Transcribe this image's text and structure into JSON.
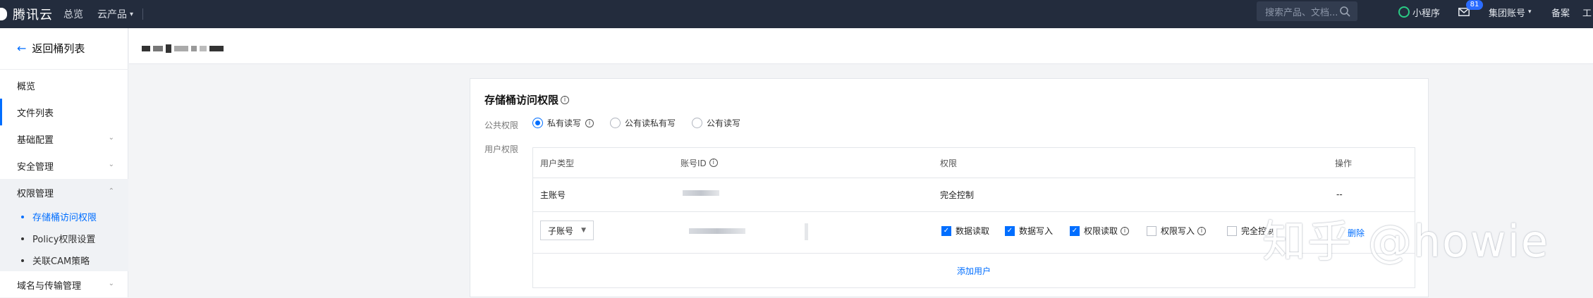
{
  "topbar": {
    "logo": "腾讯云",
    "nav": [
      "总览",
      "云产品"
    ],
    "search_placeholder": "搜索产品、文档...",
    "mini_program": "小程序",
    "mail_badge": "81",
    "account": "集团账号",
    "beian": "备案",
    "last_item": "工"
  },
  "sidebar": {
    "back_label": "返回桶列表",
    "items": [
      {
        "label": "概览"
      },
      {
        "label": "文件列表"
      },
      {
        "label": "基础配置"
      },
      {
        "label": "安全管理"
      },
      {
        "label": "权限管理"
      }
    ],
    "sub_items": [
      {
        "label": "存储桶访问权限"
      },
      {
        "label": "Policy权限设置"
      },
      {
        "label": "关联CAM策略"
      }
    ],
    "after_item": "域名与传输管理"
  },
  "card": {
    "title": "存储桶访问权限",
    "public_label": "公共权限",
    "radios": [
      "私有读写",
      "公有读私有写",
      "公有读写"
    ],
    "user_label": "用户权限",
    "table": {
      "headers": [
        "用户类型",
        "账号ID",
        "权限",
        "操作"
      ],
      "row1": {
        "type": "主账号",
        "permission": "完全控制",
        "action": "--"
      },
      "row2": {
        "select_value": "子账号",
        "checks": [
          {
            "label": "数据读取",
            "checked": true
          },
          {
            "label": "数据写入",
            "checked": true
          },
          {
            "label": "权限读取",
            "checked": true
          },
          {
            "label": "权限写入",
            "checked": false
          },
          {
            "label": "完全控制",
            "checked": false
          }
        ],
        "action": "删除"
      },
      "add_user": "添加用户"
    }
  },
  "watermark": "知乎 @howie",
  "colors": {
    "accent": "#006eff",
    "topbar_bg": "#232c3d",
    "mini_program_green": "#29cc85"
  }
}
